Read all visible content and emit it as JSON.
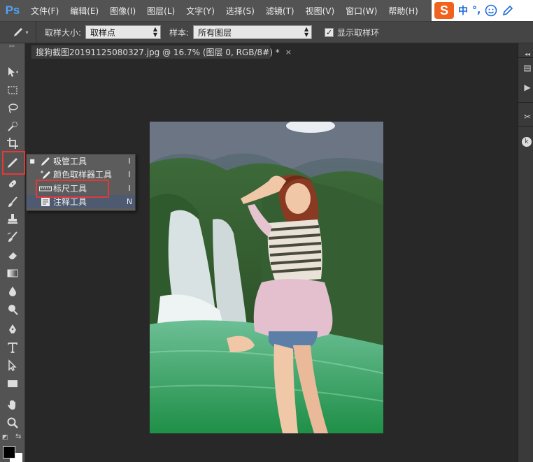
{
  "app": {
    "logo": "Ps"
  },
  "menus": [
    "文件(F)",
    "编辑(E)",
    "图像(I)",
    "图层(L)",
    "文字(Y)",
    "选择(S)",
    "滤镜(T)",
    "视图(V)",
    "窗口(W)",
    "帮助(H)"
  ],
  "ime": {
    "logo": "S",
    "mode": "中",
    "punct": "°,"
  },
  "options": {
    "sample_size_label": "取样大小:",
    "sample_size_value": "取样点",
    "sample_label": "样本:",
    "sample_value": "所有图层",
    "show_ring_label": "显示取样环",
    "show_ring_checked": "✓"
  },
  "document": {
    "tab_title": "搜狗截图20191125080327.jpg @ 16.7% (图层 0, RGB/8#) *",
    "close": "×"
  },
  "flyout": {
    "items": [
      {
        "label": "吸管工具",
        "key": "I",
        "active": "■",
        "icon": "eyedropper-icon"
      },
      {
        "label": "颜色取样器工具",
        "key": "I",
        "active": "",
        "icon": "color-sampler-icon"
      },
      {
        "label": "标尺工具",
        "key": "I",
        "active": "",
        "icon": "ruler-icon"
      },
      {
        "label": "注释工具",
        "key": "N",
        "active": "",
        "icon": "note-icon"
      }
    ]
  },
  "colors": {
    "highlight": "#e53935",
    "foreground": "#000000",
    "background": "#ffffff"
  }
}
